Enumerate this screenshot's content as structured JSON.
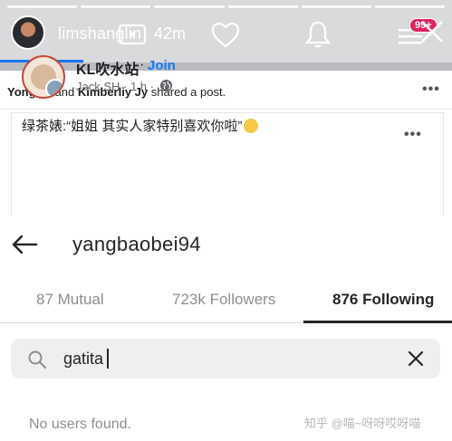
{
  "story": {
    "username": "limshanglin",
    "time": "42m",
    "badge": "99+",
    "icons": [
      "igtv-icon",
      "heart-icon",
      "bell-icon",
      "menu-icon",
      "close-icon"
    ]
  },
  "feed": {
    "shared_user_1": "Yong Qi",
    "shared_and": "and",
    "shared_user_2": "Kimberliy Jy",
    "shared_suffix": "shared a post.",
    "post": {
      "page_name": "KL吹水站",
      "dot": "·",
      "join_label": "Join",
      "author_meta": "Jack SH · 1 h ·",
      "text": "绿茶婊:“姐姐 其实人家特别喜欢你啦”"
    }
  },
  "profile": {
    "username": "yangbaobei94",
    "tabs": [
      {
        "label": "87 Mutual",
        "active": false
      },
      {
        "label": "723k Followers",
        "active": false
      },
      {
        "label": "876 Following",
        "active": true
      }
    ],
    "search": {
      "value": "gatita",
      "placeholder": "Search"
    },
    "empty_message": "No users found."
  },
  "watermark": "知乎 @喵~呀呀哎呀喵"
}
